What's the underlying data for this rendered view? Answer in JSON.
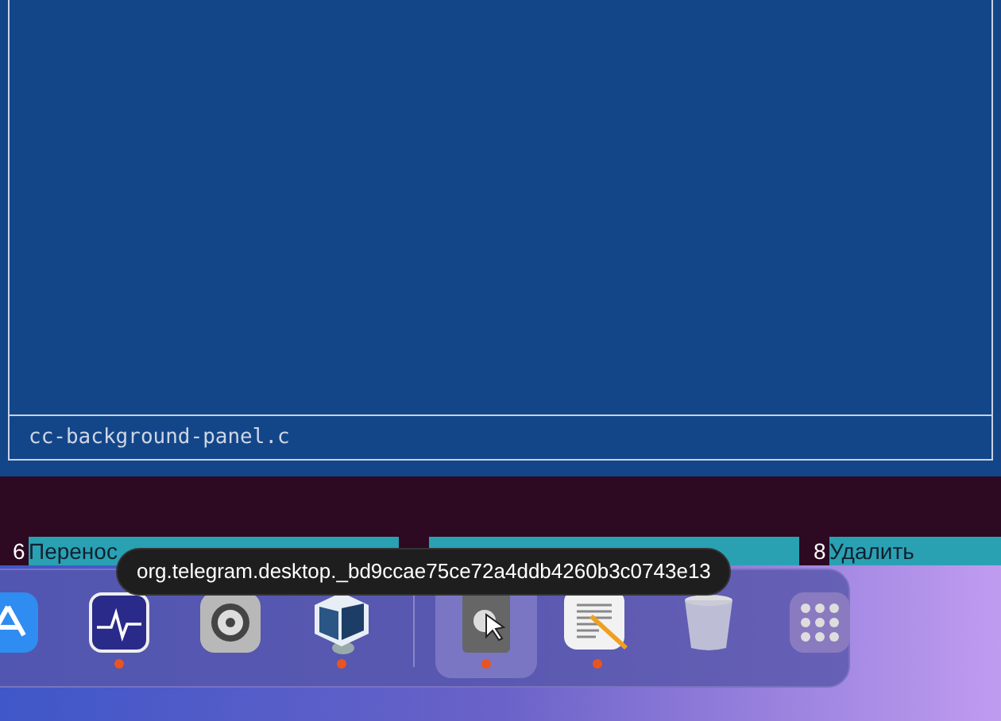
{
  "editor_panel": {
    "filename": "cc-background-panel.c"
  },
  "function_keys": [
    {
      "kind": "labeled",
      "number": "6",
      "label": "Перенос"
    },
    {
      "kind": "covered"
    },
    {
      "kind": "labeled",
      "number": "8",
      "label": "Удалить"
    }
  ],
  "tooltip": {
    "text": "org.telegram.desktop._bd9ccae75ce72a4ddb4260b3c0743e13"
  },
  "dock": {
    "groups": [
      [
        {
          "kind": "store",
          "running": false,
          "hovered": false
        },
        {
          "kind": "monitor",
          "running": true,
          "hovered": false
        },
        {
          "kind": "settings",
          "running": false,
          "hovered": false
        },
        {
          "kind": "virtualbox",
          "running": true,
          "hovered": false
        }
      ],
      [
        {
          "kind": "generic",
          "running": true,
          "hovered": true
        },
        {
          "kind": "editor",
          "running": true,
          "hovered": false
        },
        {
          "kind": "trash",
          "running": false,
          "hovered": false
        },
        {
          "kind": "apps",
          "running": false,
          "hovered": false
        }
      ]
    ]
  }
}
